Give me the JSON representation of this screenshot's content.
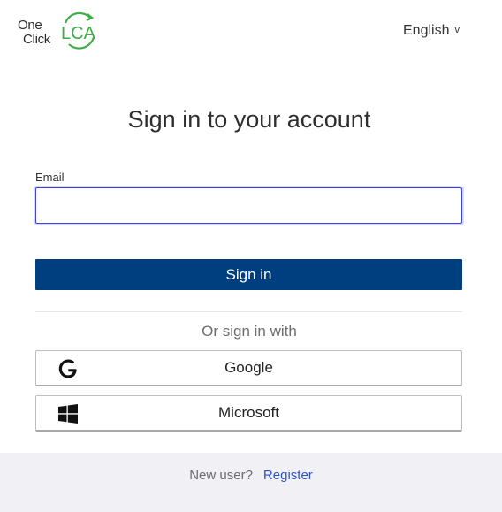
{
  "header": {
    "logo": {
      "word_one": "One",
      "word_click": "Click",
      "word_lca": "LCA",
      "brand_green": "#3fae49"
    },
    "language": {
      "selected": "English",
      "chevron": "v"
    }
  },
  "main": {
    "title": "Sign in to your account",
    "email": {
      "label": "Email",
      "value": "",
      "placeholder": ""
    },
    "signin_button": "Sign in",
    "divider_text": "Or sign in with",
    "social": [
      {
        "label": "Google",
        "icon": "google-icon"
      },
      {
        "label": "Microsoft",
        "icon": "windows-icon"
      }
    ]
  },
  "footer": {
    "new_user_text": "New user?",
    "register_link": "Register"
  },
  "colors": {
    "primary_button": "#003f7f",
    "link": "#2d55c8",
    "footer_bg": "#f1f1f5",
    "input_focus": "#3b44d6"
  }
}
